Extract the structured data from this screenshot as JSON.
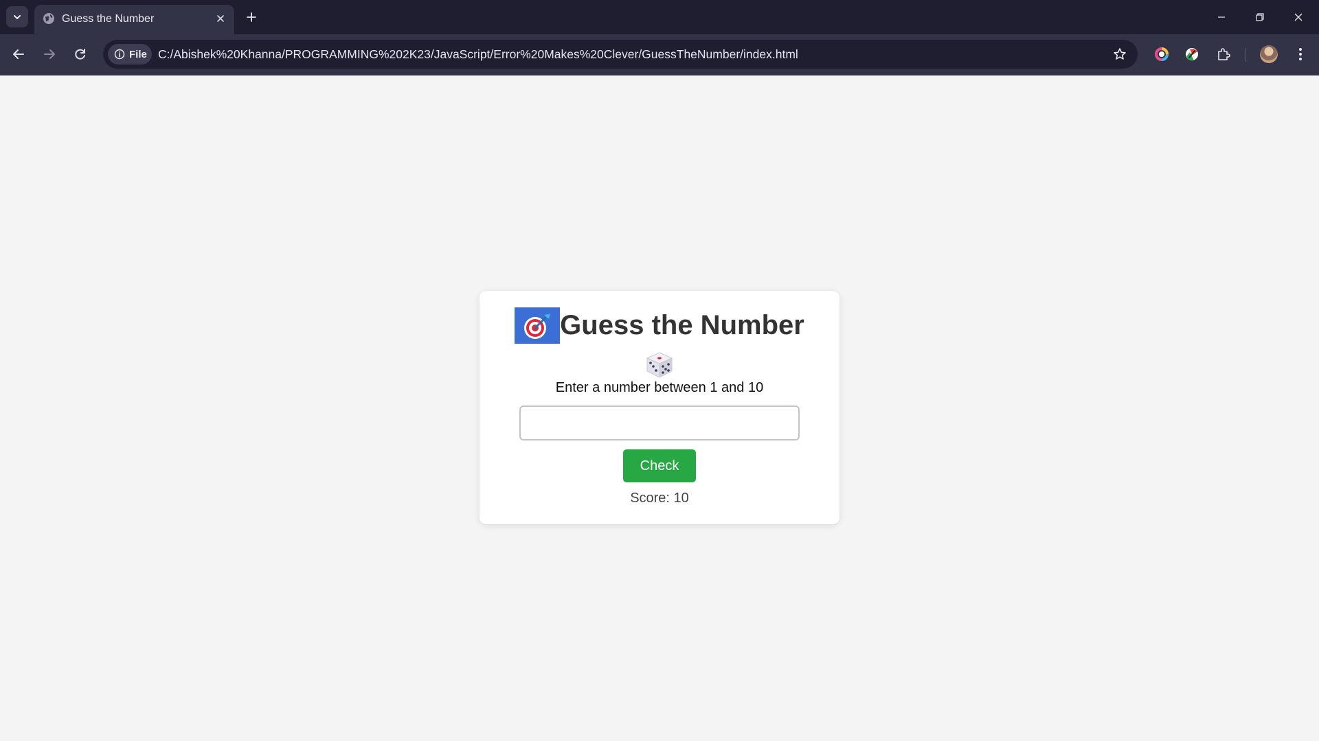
{
  "browser": {
    "tab": {
      "title": "Guess the Number"
    },
    "omnibox": {
      "security_chip": "File",
      "url": "C:/Abishek%20Khanna/PROGRAMMING%202K23/JavaScript/Error%20Makes%20Clever/GuessTheNumber/index.html"
    },
    "icons": {
      "tab_search": "chevron-down-icon",
      "favicon": "globe-icon",
      "tab_close": "close-icon",
      "new_tab": "plus-icon",
      "minimize": "minimize-icon",
      "restore": "restore-icon",
      "close_window": "close-icon",
      "back": "back-arrow-icon",
      "forward": "forward-arrow-icon",
      "reload": "reload-icon",
      "info": "info-icon",
      "bookmark": "star-icon",
      "extensions": "puzzle-icon",
      "menu": "kebab-menu-icon"
    },
    "colors": {
      "titlebar": "#1e1e30",
      "toolbar": "#333347"
    }
  },
  "game": {
    "title": "Guess the Number",
    "title_emoji": "target-icon",
    "dice_emoji": "dice-icon",
    "prompt": "Enter a number between 1 and 10",
    "input": {
      "value": "",
      "placeholder": ""
    },
    "check_label": "Check",
    "score": "Score: 10",
    "colors": {
      "background": "#f4f4f4",
      "card": "#ffffff",
      "button": "#28a745"
    }
  }
}
